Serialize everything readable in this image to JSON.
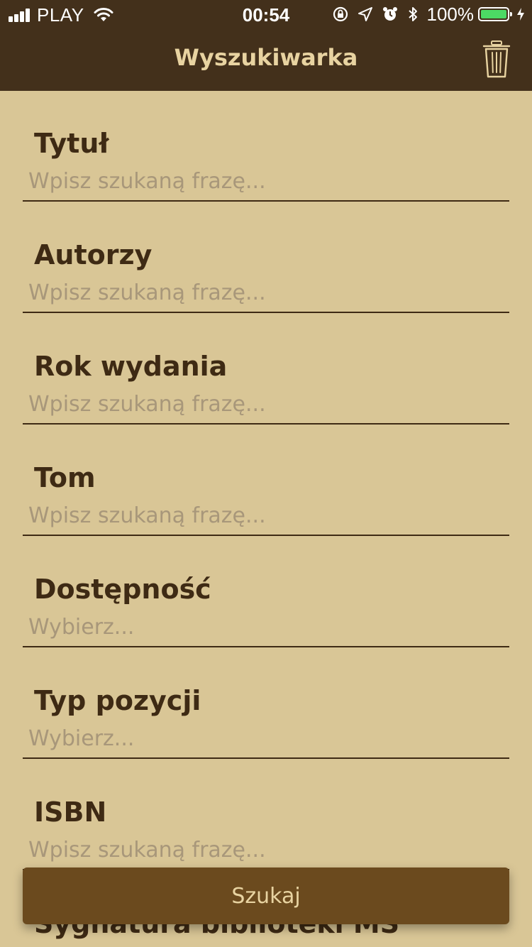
{
  "status_bar": {
    "carrier": "PLAY",
    "time": "00:54",
    "battery": "100%",
    "icons": [
      "signal-icon",
      "wifi-icon",
      "orientation-lock-icon",
      "location-icon",
      "alarm-icon",
      "bluetooth-icon",
      "battery-icon",
      "charging-icon"
    ]
  },
  "header": {
    "title": "Wyszukiwarka",
    "action_icon": "trash-icon"
  },
  "form": {
    "fields": [
      {
        "label": "Tytuł",
        "placeholder": "Wpisz szukaną frazę...",
        "value": ""
      },
      {
        "label": "Autorzy",
        "placeholder": "Wpisz szukaną frazę...",
        "value": ""
      },
      {
        "label": "Rok wydania",
        "placeholder": "Wpisz szukaną frazę...",
        "value": ""
      },
      {
        "label": "Tom",
        "placeholder": "Wpisz szukaną frazę...",
        "value": ""
      },
      {
        "label": "Dostępność",
        "placeholder": "Wybierz...",
        "value": ""
      },
      {
        "label": "Typ pozycji",
        "placeholder": "Wybierz...",
        "value": ""
      },
      {
        "label": "ISBN",
        "placeholder": "Wpisz szukaną frazę...",
        "value": ""
      },
      {
        "label": "Sygnatura biblioteki MS",
        "placeholder": "",
        "value": ""
      }
    ],
    "submit_label": "Szukaj"
  },
  "colors": {
    "header_bg": "#43301b",
    "page_bg": "#d9c696",
    "label_text": "#3e2a14",
    "placeholder_text": "#a8977a",
    "button_bg": "#6b4a1e",
    "button_text": "#e8d3a1",
    "battery_fill": "#4cd964"
  }
}
